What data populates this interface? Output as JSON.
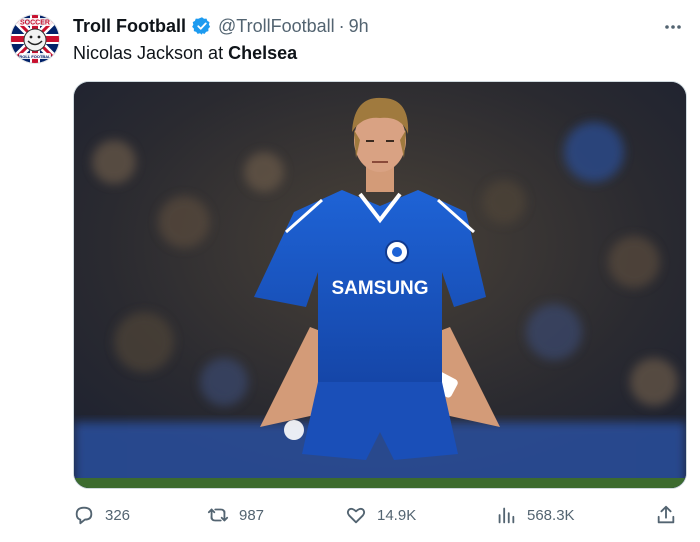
{
  "tweet": {
    "author_name": "Troll Football",
    "handle": "@TrollFootball",
    "separator": "·",
    "time": "9h",
    "text_prefix": "Nicolas Jackson at ",
    "text_bold": "Chelsea",
    "image_kit_text": "SAMSUNG",
    "verified_color": "#1d9bf0"
  },
  "avatar": {
    "top_text": "SOCCER",
    "bottom_text": "TROLL FOOTBALL"
  },
  "actions": {
    "reply_count": "326",
    "retweet_count": "987",
    "like_count": "14.9K",
    "views_count": "568.3K"
  },
  "icons": {
    "more": "more-icon",
    "reply": "reply-icon",
    "retweet": "retweet-icon",
    "like": "like-icon",
    "views": "views-icon",
    "share": "share-icon",
    "verified": "verified-badge-icon"
  }
}
